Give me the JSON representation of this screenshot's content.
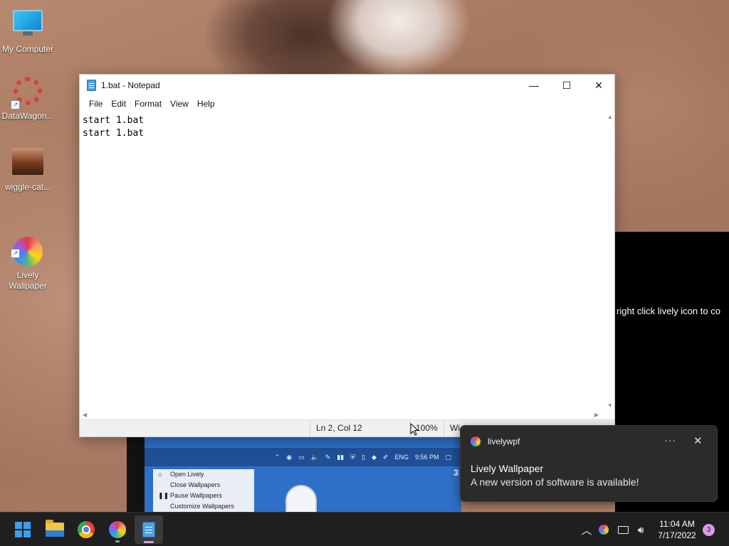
{
  "desktop": {
    "icons": [
      {
        "label": "My Computer"
      },
      {
        "label": "DataWagon..."
      },
      {
        "label": "wiggle-cat..."
      },
      {
        "label": "Lively\nWallpaper"
      }
    ],
    "wallpaper_caption": "right click lively icon to co",
    "preview": {
      "tray_lang": "ENG",
      "tray_time": "9:56 PM",
      "menu": [
        "Open Lively",
        "Close Wallpapers",
        "Pause Wallpapers",
        "Customize Wallpapers"
      ],
      "badge": "3"
    }
  },
  "notepad": {
    "title": "1.bat - Notepad",
    "controls": {
      "minimize": "—",
      "maximize": "☐",
      "close": "✕"
    },
    "menu": [
      "File",
      "Edit",
      "Format",
      "View",
      "Help"
    ],
    "content": "start 1.bat\nstart 1.bat",
    "status": {
      "position": "Ln 2, Col 12",
      "zoom": "100%",
      "line_ending": "Wi"
    }
  },
  "toast": {
    "app": "livelywpf",
    "more": "···",
    "close": "✕",
    "title": "Lively Wallpaper",
    "body": "A new version of software is available!"
  },
  "taskbar": {
    "apps": [
      "Start",
      "File Explorer",
      "Google Chrome",
      "Lively Wallpaper",
      "Notepad"
    ],
    "tray": {
      "chevron": "^",
      "time": "11:04 AM",
      "date": "7/17/2022",
      "notification_count": "3"
    }
  },
  "colors": {
    "taskbar_bg": "#1f1f1f",
    "toast_bg": "#2b2b2b",
    "accent": "#d99be6"
  }
}
